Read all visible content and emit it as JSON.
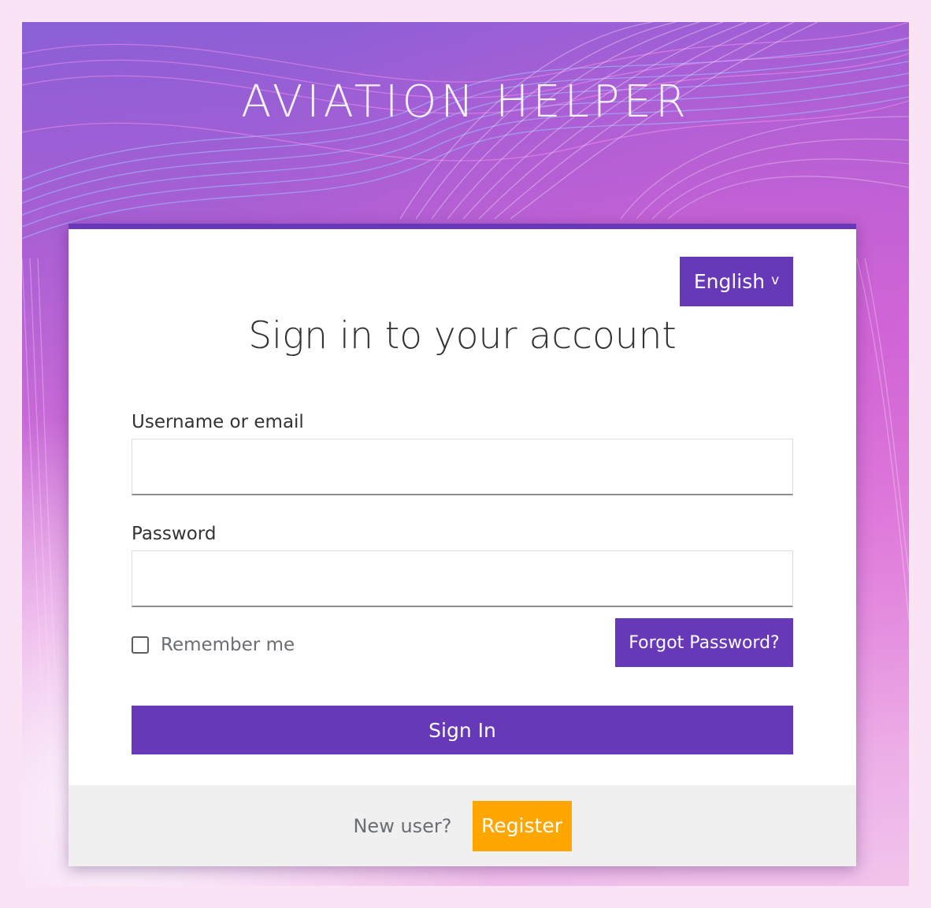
{
  "brand": {
    "title": "AVIATION HELPER"
  },
  "login": {
    "language_label": "English",
    "language_chevron": "v",
    "heading": "Sign in to your account",
    "username_label": "Username or email",
    "username_value": "",
    "password_label": "Password",
    "password_value": "",
    "remember_label": "Remember me",
    "remember_checked": false,
    "forgot_label": "Forgot Password?",
    "signin_label": "Sign In"
  },
  "footer": {
    "new_user_text": "New user?",
    "register_label": "Register"
  },
  "colors": {
    "primary": "#6739b8",
    "register": "#ffa600",
    "page_background": "#f9e3f5",
    "footer_background": "#f0f0f0"
  },
  "icons": {
    "language_dropdown": "chevron-down-icon",
    "remember": "checkbox-unchecked"
  }
}
